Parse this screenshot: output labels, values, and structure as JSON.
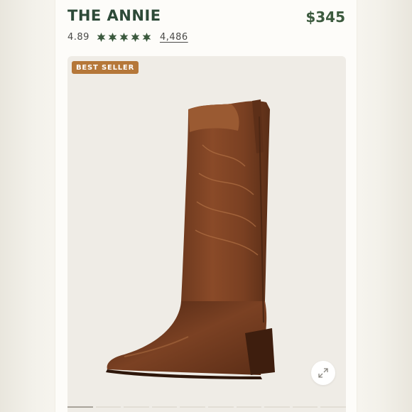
{
  "product": {
    "title": "THE ANNIE",
    "price": "$345",
    "rating": "4.89",
    "stars": 5,
    "review_count": "4,486",
    "badge": "BEST SELLER"
  },
  "gallery": {
    "image": "brown-leather-cowboy-boot",
    "slides": 10,
    "active_slide": 1
  },
  "icons": {
    "expand": "expand-icon",
    "star": "star-icon"
  },
  "colors": {
    "title": "#2d4a38",
    "price": "#3c5a3e",
    "badge": "#b57739",
    "panel": "#efece6"
  }
}
